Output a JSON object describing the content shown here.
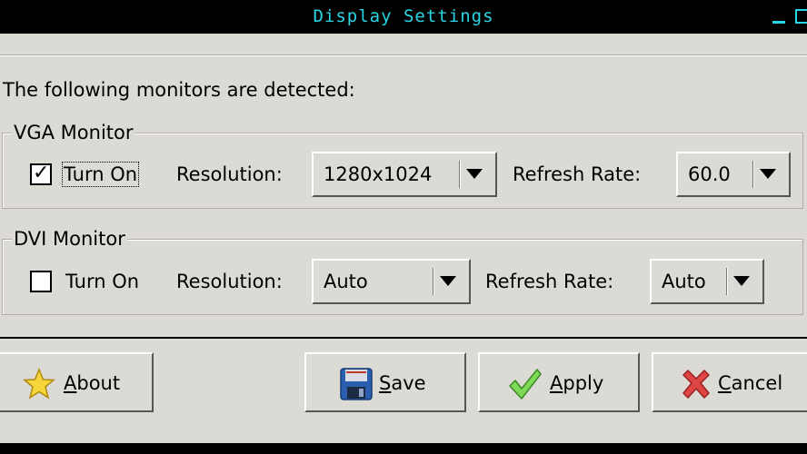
{
  "window": {
    "title": "Display Settings"
  },
  "prompt": "The following monitors are detected:",
  "vga": {
    "legend": "VGA Monitor",
    "turn_on_label": "Turn On",
    "turn_on_checked": true,
    "resolution_label": "Resolution:",
    "resolution_value": "1280x1024",
    "refresh_label": "Refresh Rate:",
    "refresh_value": "60.0"
  },
  "dvi": {
    "legend": "DVI Monitor",
    "turn_on_label": "Turn On",
    "turn_on_checked": false,
    "resolution_label": "Resolution:",
    "resolution_value": "Auto",
    "refresh_label": "Refresh Rate:",
    "refresh_value": "Auto"
  },
  "buttons": {
    "about": {
      "first": "A",
      "rest": "bout"
    },
    "save": {
      "first": "S",
      "rest": "ave"
    },
    "apply": {
      "first": "A",
      "rest": "pply"
    },
    "cancel": {
      "first": "C",
      "rest": "ancel"
    }
  },
  "colors": {
    "title_text": "#27d7e6",
    "window_bg": "#dcdad5"
  }
}
